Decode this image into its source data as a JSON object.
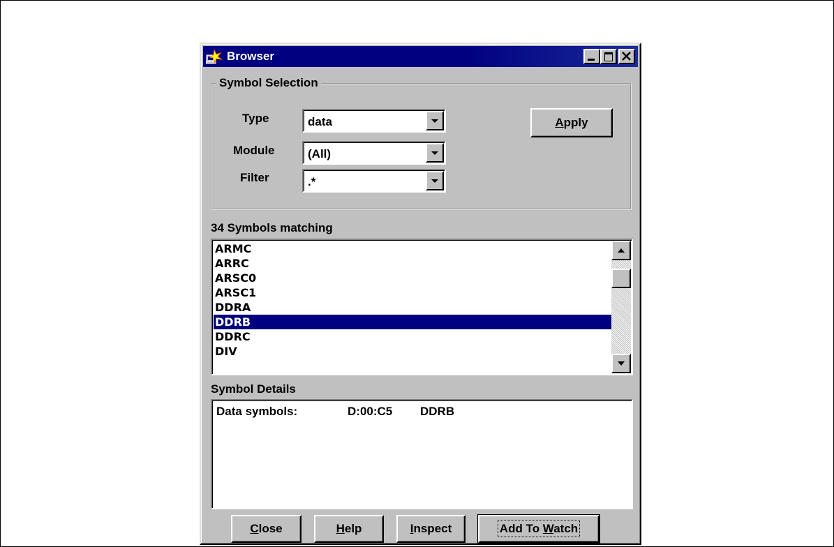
{
  "window": {
    "title": "Browser"
  },
  "symbol_selection": {
    "label": "Symbol Selection",
    "type_label": "Type",
    "type_value": "data",
    "module_label": "Module",
    "module_value": "(All)",
    "filter_label": "Filter",
    "filter_value": ".*",
    "apply_prefix": "",
    "apply_hotkey": "A",
    "apply_rest": "pply"
  },
  "symbols": {
    "count_label": "34 Symbols matching",
    "items": [
      "ARMC",
      "ARRC",
      "ARSC0",
      "ARSC1",
      "DDRA",
      "DDRB",
      "DDRC",
      "DIV"
    ],
    "selected": "DDRB"
  },
  "details": {
    "label": "Symbol Details",
    "kind": "Data symbols:",
    "address": "D:00:C5",
    "name": "DDRB"
  },
  "buttons": {
    "close_hotkey": "C",
    "close_rest": "lose",
    "help_hotkey": "H",
    "help_rest": "elp",
    "inspect_hotkey": "I",
    "inspect_rest": "nspect",
    "watch_prefix": "Add To ",
    "watch_hotkey": "W",
    "watch_rest": "atch"
  }
}
